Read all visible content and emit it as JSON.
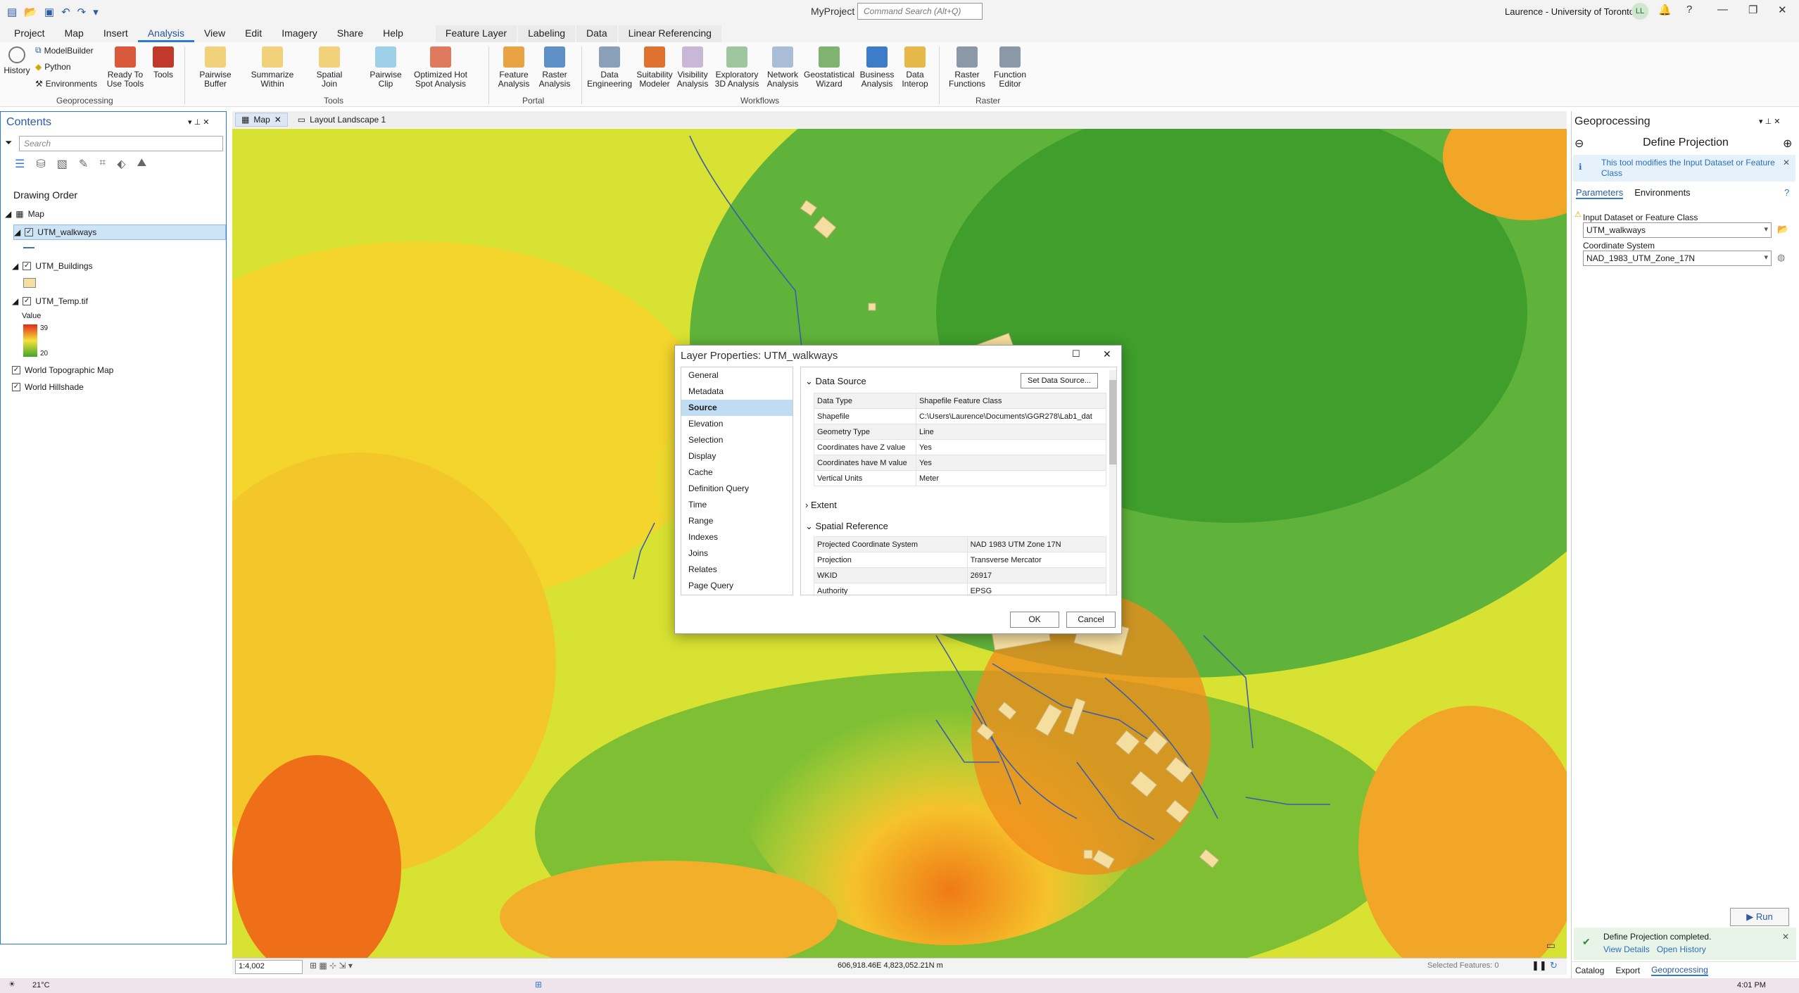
{
  "app": {
    "title": "MyProject",
    "command_search_placeholder": "Command Search (Alt+Q)",
    "user": "Laurence - University of Toronto",
    "user_initials": "LL"
  },
  "ribbon": {
    "tabs": [
      "Project",
      "Map",
      "Insert",
      "Analysis",
      "View",
      "Edit",
      "Imagery",
      "Share",
      "Help"
    ],
    "active_tab": "Analysis",
    "context_tabs": [
      "Feature Layer",
      "Labeling",
      "Data",
      "Linear Referencing"
    ],
    "geoprocessing": {
      "history": "History",
      "modelbuilder": "ModelBuilder",
      "python": "Python",
      "environments": "Environments",
      "ready_to_use": "Ready To Use Tools",
      "tools": "Tools",
      "label": "Geoprocessing"
    },
    "tools_group": {
      "items": [
        "Pairwise Buffer",
        "Summarize Within",
        "Spatial Join",
        "Pairwise Clip",
        "Optimized Hot Spot Analysis"
      ],
      "label": "Tools"
    },
    "portal_group": {
      "items": [
        "Feature Analysis",
        "Raster Analysis"
      ],
      "label": "Portal"
    },
    "workflows_group": {
      "items": [
        "Data Engineering",
        "Suitability Modeler",
        "Visibility Analysis",
        "Exploratory 3D Analysis",
        "Network Analysis",
        "Geostatistical Wizard",
        "Business Analysis",
        "Data Interop"
      ],
      "label": "Workflows"
    },
    "raster_group": {
      "items": [
        "Raster Functions",
        "Function Editor"
      ],
      "label": "Raster"
    }
  },
  "contents": {
    "title": "Contents",
    "search_placeholder": "Search",
    "drawing_order": "Drawing Order",
    "map": "Map",
    "layers": [
      "UTM_walkways",
      "UTM_Buildings",
      "UTM_Temp.tif",
      "World Topographic Map",
      "World Hillshade"
    ],
    "legend_title": "Value",
    "legend_max": "39",
    "legend_min": "20"
  },
  "map_tabs": [
    "Map",
    "Layout Landscape 1"
  ],
  "map_status": {
    "scale": "1:4,002",
    "coords": "606,918.46E 4,823,052.21N m",
    "selected": "Selected Features: 0"
  },
  "dialog": {
    "title": "Layer Properties: UTM_walkways",
    "nav": [
      "General",
      "Metadata",
      "Source",
      "Elevation",
      "Selection",
      "Display",
      "Cache",
      "Definition Query",
      "Time",
      "Range",
      "Indexes",
      "Joins",
      "Relates",
      "Page Query"
    ],
    "selected_nav": "Source",
    "data_source_header": "Data Source",
    "set_data_source": "Set Data Source...",
    "data_source_rows": [
      [
        "Data Type",
        "Shapefile Feature Class"
      ],
      [
        "Shapefile",
        "C:\\Users\\Laurence\\Documents\\GGR278\\Lab1_dat"
      ],
      [
        "Geometry Type",
        "Line"
      ],
      [
        "Coordinates have Z value",
        "Yes"
      ],
      [
        "Coordinates have M value",
        "Yes"
      ],
      [
        "Vertical Units",
        "Meter"
      ]
    ],
    "extent_header": "Extent",
    "spatial_ref_header": "Spatial Reference",
    "spatial_ref_rows": [
      [
        "Projected Coordinate System",
        "NAD 1983 UTM Zone 17N"
      ],
      [
        "Projection",
        "Transverse Mercator"
      ],
      [
        "WKID",
        "26917"
      ],
      [
        "Authority",
        "EPSG"
      ]
    ],
    "ok": "OK",
    "cancel": "Cancel"
  },
  "geoprocessing": {
    "pane_title": "Geoprocessing",
    "tool_title": "Define Projection",
    "info": "This tool modifies the Input Dataset or Feature Class",
    "tabs": [
      "Parameters",
      "Environments"
    ],
    "input_label": "Input Dataset or Feature Class",
    "input_value": "UTM_walkways",
    "cs_label": "Coordinate System",
    "cs_value": "NAD_1983_UTM_Zone_17N",
    "run": "Run",
    "result": "Define Projection completed.",
    "view_details": "View Details",
    "open_history": "Open History",
    "bottom_tabs": [
      "Catalog",
      "Export",
      "Geoprocessing"
    ]
  },
  "taskbar": {
    "weather": "21°C",
    "time": "4:01 PM"
  }
}
